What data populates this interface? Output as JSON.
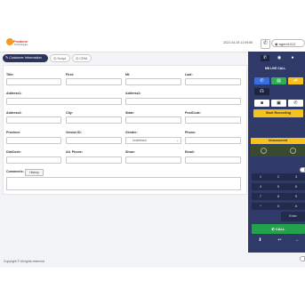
{
  "header": {
    "logo_text": "Prodenv",
    "logo_sub": "Technologies",
    "datetime": "2022-04-28 11:09:56",
    "user": "agent1012"
  },
  "tabs": [
    {
      "label": "Customer Information"
    },
    {
      "label": "Script"
    },
    {
      "label": "CRM"
    }
  ],
  "form": {
    "title": "Title:",
    "first": "First:",
    "mi": "MI:",
    "last": "Last :",
    "address1": "Address1:",
    "address2": "Address2:",
    "address3": "Address3:",
    "city": "City:",
    "state": "State:",
    "postcode": "PostCode:",
    "province": "Province:",
    "vendor_id": "Vendor ID:",
    "gender": "Gender:",
    "gender_value": "Undefined",
    "phone": "Phone:",
    "dial_code": "DialCode:",
    "alt_phone": "Alt. Phone:",
    "show": "Show:",
    "email": "Email:",
    "comments": "Comments:",
    "history_button": "History"
  },
  "footer": {
    "copyright": "Copyright © All rights reserved"
  },
  "dialer": {
    "line_label": "NB LIVE CALL",
    "start_recording": "Start Recording",
    "unanswered": "Unanswered",
    "keys": [
      "1",
      "2",
      "3",
      "4",
      "5",
      "6",
      "7",
      "8",
      "9",
      "*",
      "0",
      "#"
    ],
    "enter": "Enter",
    "call": "CALL"
  }
}
